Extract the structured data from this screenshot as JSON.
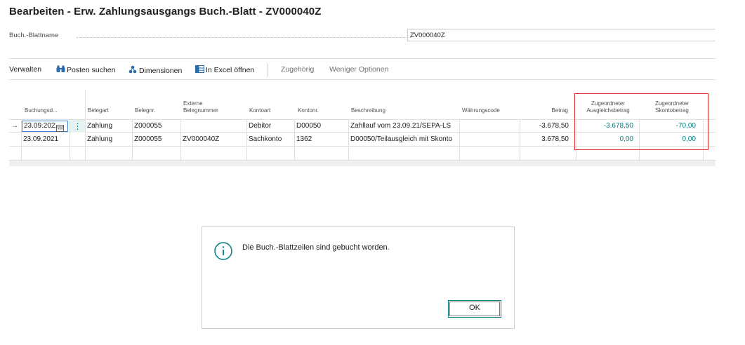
{
  "title": "Bearbeiten - Erw. Zahlungsausgangs Buch.-Blatt - ZV000040Z",
  "journal_field": {
    "label": "Buch.-Blattname",
    "value": "ZV000040Z"
  },
  "toolbar": {
    "verwalten": "Verwalten",
    "posten_suchen": "Posten suchen",
    "dimensionen": "Dimensionen",
    "excel": "In Excel öffnen",
    "zugehoerig": "Zugehörig",
    "weniger": "Weniger Optionen"
  },
  "columns": {
    "buchungsdatum": "Buchungsd...",
    "belegart": "Belegart",
    "belegnr": "Belegnr.",
    "externe_l1": "Externe",
    "externe_l2": "Belegnummer",
    "kontoart": "Kontoart",
    "kontonr": "Kontonr.",
    "beschreibung": "Beschreibung",
    "waehrung": "Währungscode",
    "betrag": "Betrag",
    "ausgl_l1": "Zugeordneter",
    "ausgl_l2": "Ausgleichsbetrag",
    "skonto_l1": "Zugeordneter",
    "skonto_l2": "Skontobetrag"
  },
  "rows": [
    {
      "datum": "23.09.2021",
      "belegart": "Zahlung",
      "belegnr": "Z000055",
      "extern": "",
      "kontoart": "Debitor",
      "kontonr": "D00050",
      "beschreibung": "Zahllauf vom 23.09.21/SEPA-LS",
      "waehrung": "",
      "betrag": "-3.678,50",
      "ausgleich": "-3.678,50",
      "skonto": "-70,00"
    },
    {
      "datum": "23.09.2021",
      "belegart": "Zahlung",
      "belegnr": "Z000055",
      "extern": "ZV000040Z",
      "kontoart": "Sachkonto",
      "kontonr": "1362",
      "beschreibung": "D00050/Teilausgleich mit Skonto",
      "waehrung": "",
      "betrag": "3.678,50",
      "ausgleich": "0,00",
      "skonto": "0,00"
    }
  ],
  "active_row_marker": "→",
  "more_menu": "⋮",
  "dialog": {
    "message": "Die Buch.-Blattzeilen sind gebucht worden.",
    "ok_label": "OK"
  },
  "colors": {
    "accent": "#007e7e",
    "highlight_box": "#e0312b",
    "focus_border": "#3e8ad6"
  }
}
